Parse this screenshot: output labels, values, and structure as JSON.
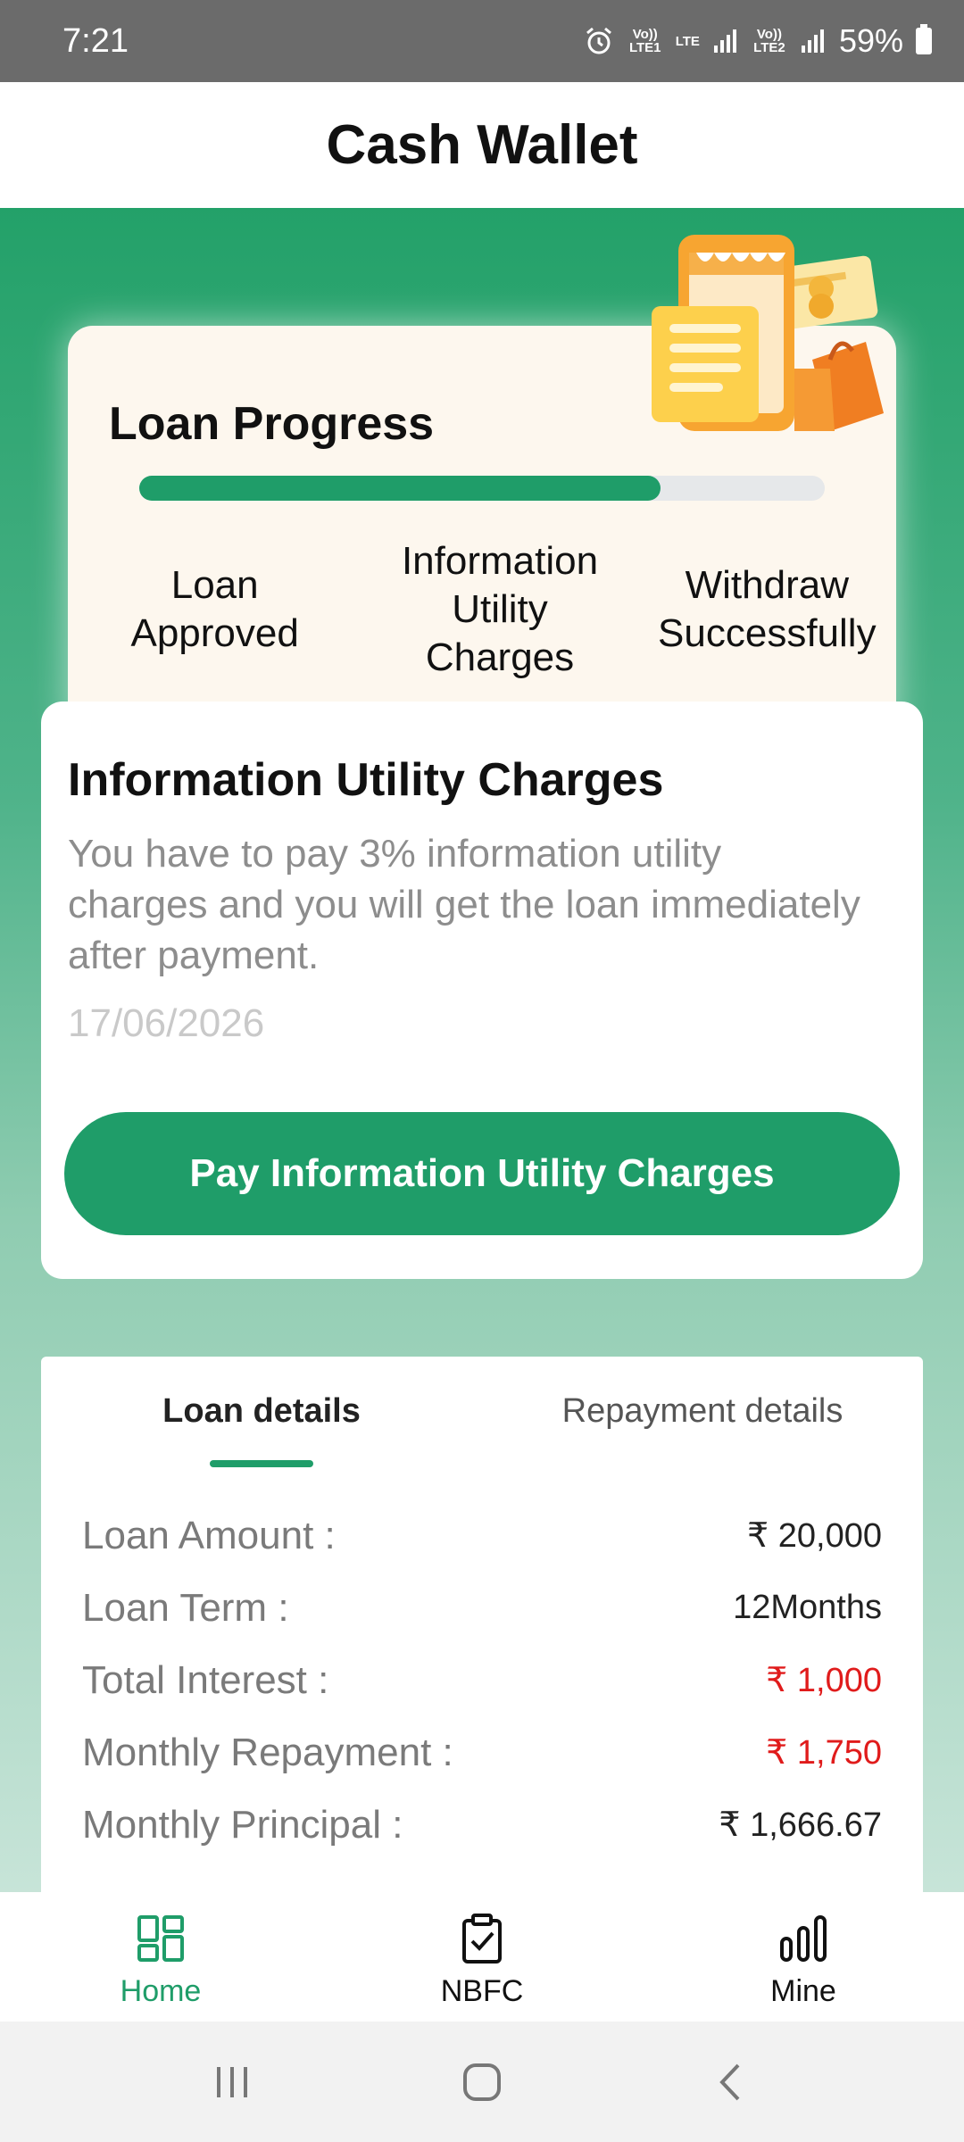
{
  "status_bar": {
    "time": "7:21",
    "sim1_label": "Vo)) LTE1",
    "lte_label": "LTE",
    "sim2_label": "Vo)) LTE2",
    "battery_percent": "59%"
  },
  "header": {
    "title": "Cash Wallet"
  },
  "progress": {
    "title": "Loan Progress",
    "fill_fraction": 0.76,
    "steps": [
      {
        "label": "Loan Approved"
      },
      {
        "label": "Information Utility Charges"
      },
      {
        "label": "Withdraw Successfully"
      }
    ]
  },
  "charges": {
    "title": "Information Utility Charges",
    "description": "You have to pay 3% information utility charges and you will get the loan immediately after payment.",
    "date": "17/06/2026",
    "button_label": "Pay Information Utility Charges"
  },
  "details": {
    "tabs": [
      {
        "label": "Loan details",
        "active": true
      },
      {
        "label": "Repayment details",
        "active": false
      }
    ],
    "rows": [
      {
        "label": "Loan Amount :",
        "value": "₹ 20,000",
        "color": "#222222"
      },
      {
        "label": "Loan Term :",
        "value": "12Months",
        "color": "#222222"
      },
      {
        "label": "Total Interest :",
        "value": "₹ 1,000",
        "color": "#e01b1b"
      },
      {
        "label": "Monthly Repayment :",
        "value": "₹ 1,750",
        "color": "#e01b1b"
      },
      {
        "label": "Monthly Principal :",
        "value": "₹ 1,666.67",
        "color": "#222222"
      }
    ]
  },
  "bottom_nav": {
    "items": [
      {
        "label": "Home",
        "icon": "grid-icon",
        "active": true
      },
      {
        "label": "NBFC",
        "icon": "clipboard-check-icon",
        "active": false
      },
      {
        "label": "Mine",
        "icon": "bar-chart-icon",
        "active": false
      }
    ]
  },
  "colors": {
    "accent": "#1f9d69",
    "danger": "#e01b1b"
  }
}
